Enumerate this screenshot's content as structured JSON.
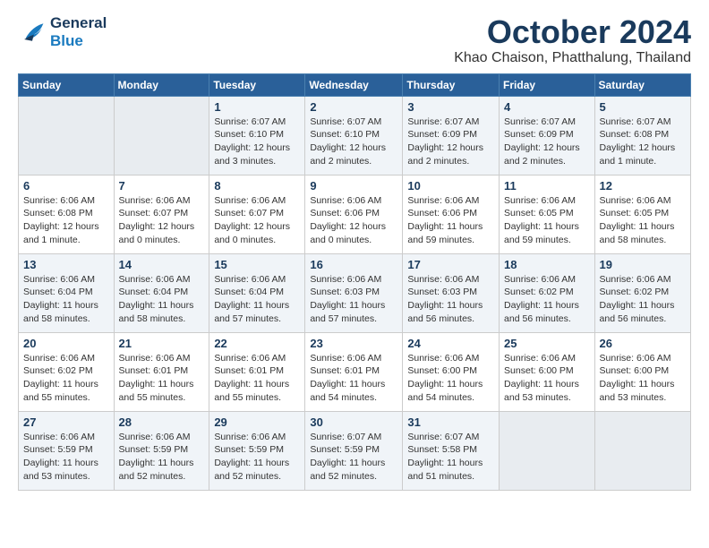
{
  "logo": {
    "line1": "General",
    "line2": "Blue"
  },
  "title": "October 2024",
  "location": "Khao Chaison, Phatthalung, Thailand",
  "weekdays": [
    "Sunday",
    "Monday",
    "Tuesday",
    "Wednesday",
    "Thursday",
    "Friday",
    "Saturday"
  ],
  "weeks": [
    [
      {
        "day": "",
        "empty": true
      },
      {
        "day": "",
        "empty": true
      },
      {
        "day": "1",
        "sunrise": "6:07 AM",
        "sunset": "6:10 PM",
        "daylight": "12 hours and 3 minutes."
      },
      {
        "day": "2",
        "sunrise": "6:07 AM",
        "sunset": "6:10 PM",
        "daylight": "12 hours and 2 minutes."
      },
      {
        "day": "3",
        "sunrise": "6:07 AM",
        "sunset": "6:09 PM",
        "daylight": "12 hours and 2 minutes."
      },
      {
        "day": "4",
        "sunrise": "6:07 AM",
        "sunset": "6:09 PM",
        "daylight": "12 hours and 2 minutes."
      },
      {
        "day": "5",
        "sunrise": "6:07 AM",
        "sunset": "6:08 PM",
        "daylight": "12 hours and 1 minute."
      }
    ],
    [
      {
        "day": "6",
        "sunrise": "6:06 AM",
        "sunset": "6:08 PM",
        "daylight": "12 hours and 1 minute."
      },
      {
        "day": "7",
        "sunrise": "6:06 AM",
        "sunset": "6:07 PM",
        "daylight": "12 hours and 0 minutes."
      },
      {
        "day": "8",
        "sunrise": "6:06 AM",
        "sunset": "6:07 PM",
        "daylight": "12 hours and 0 minutes."
      },
      {
        "day": "9",
        "sunrise": "6:06 AM",
        "sunset": "6:06 PM",
        "daylight": "12 hours and 0 minutes."
      },
      {
        "day": "10",
        "sunrise": "6:06 AM",
        "sunset": "6:06 PM",
        "daylight": "11 hours and 59 minutes."
      },
      {
        "day": "11",
        "sunrise": "6:06 AM",
        "sunset": "6:05 PM",
        "daylight": "11 hours and 59 minutes."
      },
      {
        "day": "12",
        "sunrise": "6:06 AM",
        "sunset": "6:05 PM",
        "daylight": "11 hours and 58 minutes."
      }
    ],
    [
      {
        "day": "13",
        "sunrise": "6:06 AM",
        "sunset": "6:04 PM",
        "daylight": "11 hours and 58 minutes."
      },
      {
        "day": "14",
        "sunrise": "6:06 AM",
        "sunset": "6:04 PM",
        "daylight": "11 hours and 58 minutes."
      },
      {
        "day": "15",
        "sunrise": "6:06 AM",
        "sunset": "6:04 PM",
        "daylight": "11 hours and 57 minutes."
      },
      {
        "day": "16",
        "sunrise": "6:06 AM",
        "sunset": "6:03 PM",
        "daylight": "11 hours and 57 minutes."
      },
      {
        "day": "17",
        "sunrise": "6:06 AM",
        "sunset": "6:03 PM",
        "daylight": "11 hours and 56 minutes."
      },
      {
        "day": "18",
        "sunrise": "6:06 AM",
        "sunset": "6:02 PM",
        "daylight": "11 hours and 56 minutes."
      },
      {
        "day": "19",
        "sunrise": "6:06 AM",
        "sunset": "6:02 PM",
        "daylight": "11 hours and 56 minutes."
      }
    ],
    [
      {
        "day": "20",
        "sunrise": "6:06 AM",
        "sunset": "6:02 PM",
        "daylight": "11 hours and 55 minutes."
      },
      {
        "day": "21",
        "sunrise": "6:06 AM",
        "sunset": "6:01 PM",
        "daylight": "11 hours and 55 minutes."
      },
      {
        "day": "22",
        "sunrise": "6:06 AM",
        "sunset": "6:01 PM",
        "daylight": "11 hours and 55 minutes."
      },
      {
        "day": "23",
        "sunrise": "6:06 AM",
        "sunset": "6:01 PM",
        "daylight": "11 hours and 54 minutes."
      },
      {
        "day": "24",
        "sunrise": "6:06 AM",
        "sunset": "6:00 PM",
        "daylight": "11 hours and 54 minutes."
      },
      {
        "day": "25",
        "sunrise": "6:06 AM",
        "sunset": "6:00 PM",
        "daylight": "11 hours and 53 minutes."
      },
      {
        "day": "26",
        "sunrise": "6:06 AM",
        "sunset": "6:00 PM",
        "daylight": "11 hours and 53 minutes."
      }
    ],
    [
      {
        "day": "27",
        "sunrise": "6:06 AM",
        "sunset": "5:59 PM",
        "daylight": "11 hours and 53 minutes."
      },
      {
        "day": "28",
        "sunrise": "6:06 AM",
        "sunset": "5:59 PM",
        "daylight": "11 hours and 52 minutes."
      },
      {
        "day": "29",
        "sunrise": "6:06 AM",
        "sunset": "5:59 PM",
        "daylight": "11 hours and 52 minutes."
      },
      {
        "day": "30",
        "sunrise": "6:07 AM",
        "sunset": "5:59 PM",
        "daylight": "11 hours and 52 minutes."
      },
      {
        "day": "31",
        "sunrise": "6:07 AM",
        "sunset": "5:58 PM",
        "daylight": "11 hours and 51 minutes."
      },
      {
        "day": "",
        "empty": true
      },
      {
        "day": "",
        "empty": true
      }
    ]
  ]
}
